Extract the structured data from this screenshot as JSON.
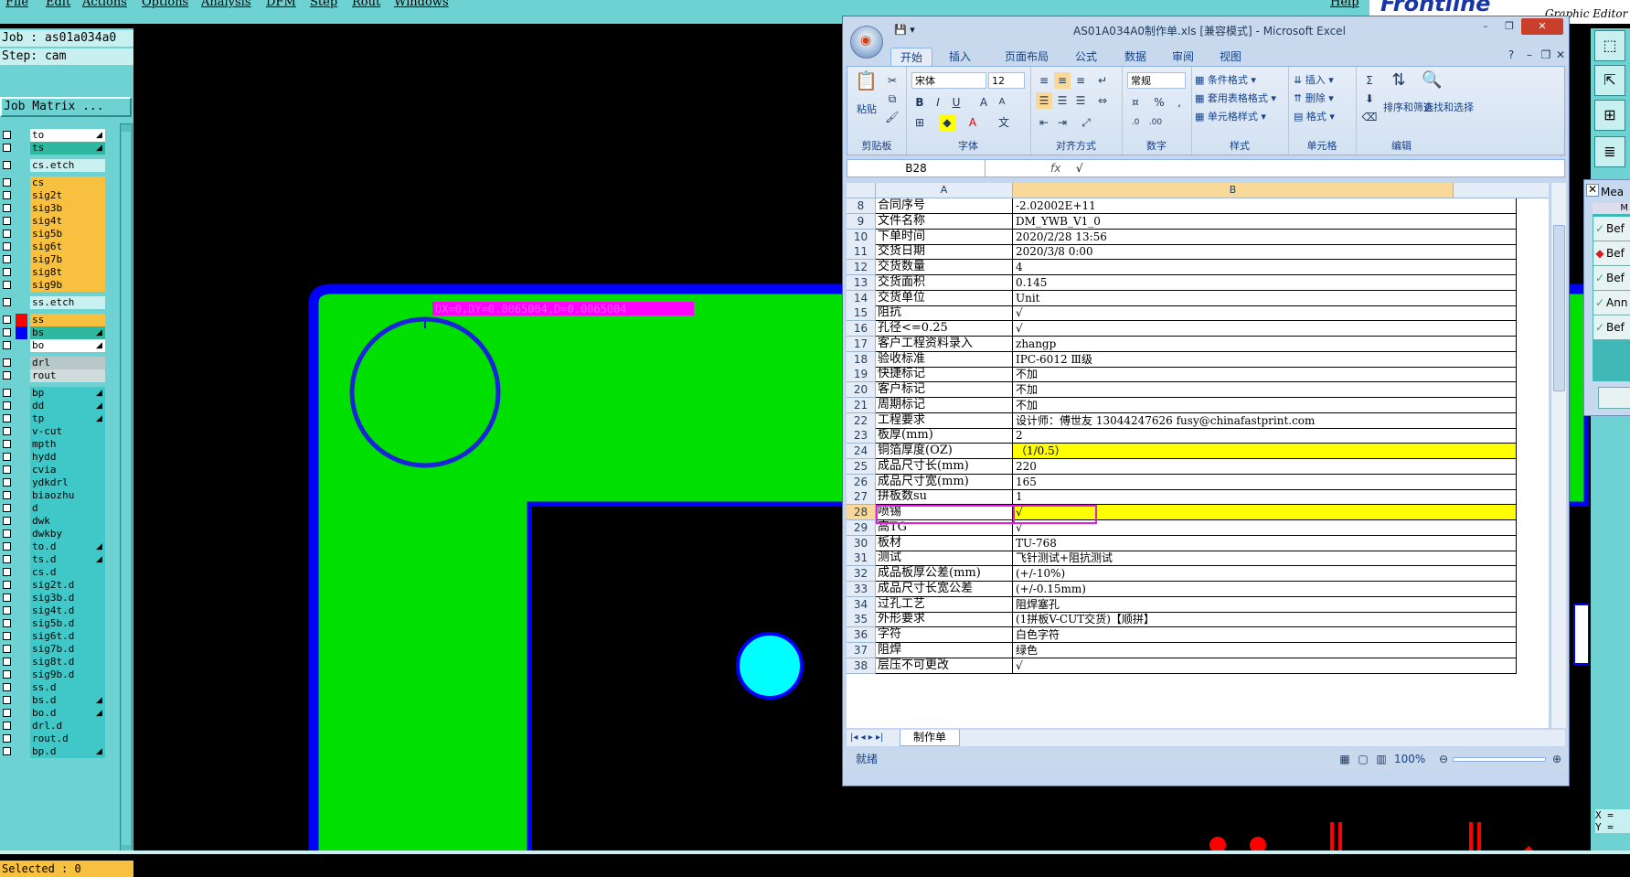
{
  "genesis": {
    "menu": [
      "File",
      "Edit",
      "Actions",
      "Options",
      "Analysis",
      "DFM",
      "Step",
      "Rout",
      "Windows"
    ],
    "help": "Help",
    "brand": "Frontline",
    "brand_sub": "Graphic Editor",
    "job_line": "Job : as01a034a0",
    "step_line": "Step: cam",
    "job_matrix": "Job Matrix ...",
    "selected": "Selected : 0",
    "measure_title": "Mea",
    "measure_header": "M",
    "measure_rows": [
      "Bef",
      "Bef",
      "Bef",
      "Ann",
      "Bef"
    ],
    "coords": [
      "X =",
      "Y ="
    ],
    "canvas_readout": "DX=0,DY=0.0065004,D=0.0065004",
    "colors": {
      "board_fill": "#00e000",
      "outline": "#0000ff",
      "readout_bg": "#ff00ff",
      "pad": "#00ffff",
      "feature_red": "#ff0000"
    }
  },
  "layers": [
    {
      "name": "to",
      "color": "#ffffff",
      "arrow": true
    },
    {
      "name": "ts",
      "color": "#2eb8a0",
      "arrow": true
    },
    {
      "name": "cs.etch",
      "color": "#c9f0f0",
      "arrow": false
    },
    {
      "name": "cs",
      "color": "#f7c03e",
      "arrow": false
    },
    {
      "name": "sig2t",
      "color": "#f7c03e",
      "arrow": false
    },
    {
      "name": "sig3b",
      "color": "#f7c03e",
      "arrow": false
    },
    {
      "name": "sig4t",
      "color": "#f7c03e",
      "arrow": false
    },
    {
      "name": "sig5b",
      "color": "#f7c03e",
      "arrow": false
    },
    {
      "name": "sig6t",
      "color": "#f7c03e",
      "arrow": false
    },
    {
      "name": "sig7b",
      "color": "#f7c03e",
      "arrow": false
    },
    {
      "name": "sig8t",
      "color": "#f7c03e",
      "arrow": false
    },
    {
      "name": "sig9b",
      "color": "#f7c03e",
      "arrow": false
    },
    {
      "name": "ss.etch",
      "color": "#c9f0f0",
      "arrow": false
    },
    {
      "name": "ss",
      "color": "#f7c03e",
      "arrow": false,
      "swatch": "#ff0000"
    },
    {
      "name": "bs",
      "color": "#2eb8a0",
      "arrow": true,
      "swatch": "#0000ff"
    },
    {
      "name": "bo",
      "color": "#ffffff",
      "arrow": true
    },
    {
      "name": "drl",
      "color": "#b8c8c8",
      "arrow": false
    },
    {
      "name": "rout",
      "color": "#d0dcdc",
      "arrow": false
    },
    {
      "name": "bp",
      "color": "#40c8c8",
      "arrow": true
    },
    {
      "name": "dd",
      "color": "#40c8c8",
      "arrow": true
    },
    {
      "name": "tp",
      "color": "#40c8c8",
      "arrow": true
    },
    {
      "name": "v-cut",
      "color": "#40c8c8",
      "arrow": false
    },
    {
      "name": "mpth",
      "color": "#40c8c8",
      "arrow": false
    },
    {
      "name": "hydd",
      "color": "#40c8c8",
      "arrow": false
    },
    {
      "name": "cvia",
      "color": "#40c8c8",
      "arrow": false
    },
    {
      "name": "ydkdrl",
      "color": "#40c8c8",
      "arrow": false
    },
    {
      "name": "biaozhu",
      "color": "#40c8c8",
      "arrow": false
    },
    {
      "name": "d",
      "color": "#40c8c8",
      "arrow": false
    },
    {
      "name": "dwk",
      "color": "#40c8c8",
      "arrow": false
    },
    {
      "name": "dwkby",
      "color": "#40c8c8",
      "arrow": false
    },
    {
      "name": "to.d",
      "color": "#40c8c8",
      "arrow": true
    },
    {
      "name": "ts.d",
      "color": "#40c8c8",
      "arrow": true
    },
    {
      "name": "cs.d",
      "color": "#40c8c8",
      "arrow": false
    },
    {
      "name": "sig2t.d",
      "color": "#40c8c8",
      "arrow": false
    },
    {
      "name": "sig3b.d",
      "color": "#40c8c8",
      "arrow": false
    },
    {
      "name": "sig4t.d",
      "color": "#40c8c8",
      "arrow": false
    },
    {
      "name": "sig5b.d",
      "color": "#40c8c8",
      "arrow": false
    },
    {
      "name": "sig6t.d",
      "color": "#40c8c8",
      "arrow": false
    },
    {
      "name": "sig7b.d",
      "color": "#40c8c8",
      "arrow": false
    },
    {
      "name": "sig8t.d",
      "color": "#40c8c8",
      "arrow": false
    },
    {
      "name": "sig9b.d",
      "color": "#40c8c8",
      "arrow": false
    },
    {
      "name": "ss.d",
      "color": "#40c8c8",
      "arrow": false
    },
    {
      "name": "bs.d",
      "color": "#40c8c8",
      "arrow": true
    },
    {
      "name": "bo.d",
      "color": "#40c8c8",
      "arrow": true
    },
    {
      "name": "drl.d",
      "color": "#40c8c8",
      "arrow": false
    },
    {
      "name": "rout.d",
      "color": "#40c8c8",
      "arrow": false
    },
    {
      "name": "bp.d",
      "color": "#40c8c8",
      "arrow": true
    }
  ],
  "excel": {
    "title": "AS01A034A0制作单.xls [兼容模式] - Microsoft Excel",
    "tabs": [
      "开始",
      "插入",
      "页面布局",
      "公式",
      "数据",
      "审阅",
      "视图"
    ],
    "ribbon": {
      "paste": "粘贴",
      "clipboard": "剪贴板",
      "font_name": "宋体",
      "font_size": "12",
      "font_group": "字体",
      "align_group": "对齐方式",
      "number_format": "常规",
      "number_group": "数字",
      "cond_format": "条件格式",
      "table_format": "套用表格格式",
      "cell_style": "单元格样式",
      "style_group": "样式",
      "insert": "插入",
      "delete": "删除",
      "format": "格式",
      "cells_group": "单元格",
      "sort_filter": "排序和筛选",
      "find_select": "查找和选择",
      "edit_group": "编辑"
    },
    "name_box": "B28",
    "fx": "fx",
    "formula_value": "√",
    "col_a": "A",
    "col_b": "B",
    "rows": [
      {
        "n": "8",
        "a": "合同序号",
        "b": "-2.02002E+11"
      },
      {
        "n": "9",
        "a": "文件名称",
        "b": "DM_YWB_V1_0"
      },
      {
        "n": "10",
        "a": "下单时间",
        "b": "2020/2/28 13:56"
      },
      {
        "n": "11",
        "a": "交货日期",
        "b": "2020/3/8 0:00"
      },
      {
        "n": "12",
        "a": "交货数量",
        "b": "4"
      },
      {
        "n": "13",
        "a": "交货面积",
        "b": "0.145"
      },
      {
        "n": "14",
        "a": "交货单位",
        "b": "Unit"
      },
      {
        "n": "15",
        "a": "阻抗",
        "b": "√"
      },
      {
        "n": "16",
        "a": "孔径<=0.25",
        "b": "√"
      },
      {
        "n": "17",
        "a": "客户工程资料录入",
        "b": "zhangp"
      },
      {
        "n": "18",
        "a": "验收标准",
        "b": "IPC-6012 Ⅲ级"
      },
      {
        "n": "19",
        "a": "快捷标记",
        "b": "不加"
      },
      {
        "n": "20",
        "a": "客户标记",
        "b": "不加"
      },
      {
        "n": "21",
        "a": "周期标记",
        "b": "不加"
      },
      {
        "n": "22",
        "a": "工程要求",
        "b": "设计师：傅世友 13044247626 fusy@chinafastprint.com"
      },
      {
        "n": "23",
        "a": "板厚(mm)",
        "b": "2"
      },
      {
        "n": "24",
        "a": "铜箔厚度(OZ)",
        "b": "（1/0.5）",
        "yellow": true
      },
      {
        "n": "25",
        "a": "成品尺寸长(mm)",
        "b": "220"
      },
      {
        "n": "26",
        "a": "成品尺寸宽(mm)",
        "b": "165"
      },
      {
        "n": "27",
        "a": "拼板数su",
        "b": "1"
      },
      {
        "n": "28",
        "a": "喷锡",
        "b": "√",
        "yellow": true,
        "selected": true
      },
      {
        "n": "29",
        "a": "高TG",
        "b": "√"
      },
      {
        "n": "30",
        "a": "板材",
        "b": "TU-768"
      },
      {
        "n": "31",
        "a": "测试",
        "b": "飞针测试+阻抗测试"
      },
      {
        "n": "32",
        "a": "成品板厚公差(mm)",
        "b": "(+/-10%)"
      },
      {
        "n": "33",
        "a": "成品尺寸长宽公差",
        "b": "(+/-0.15mm)"
      },
      {
        "n": "34",
        "a": "过孔工艺",
        "b": "阻焊塞孔"
      },
      {
        "n": "35",
        "a": "外形要求",
        "b": "(1拼板V-CUT交货)【顺拼】"
      },
      {
        "n": "36",
        "a": "字符",
        "b": "白色字符"
      },
      {
        "n": "37",
        "a": "阻焊",
        "b": "绿色"
      },
      {
        "n": "38",
        "a": "层压不可更改",
        "b": "√"
      }
    ],
    "sheet_tab": "制作单",
    "status_ready": "就绪",
    "zoom": "100%"
  }
}
